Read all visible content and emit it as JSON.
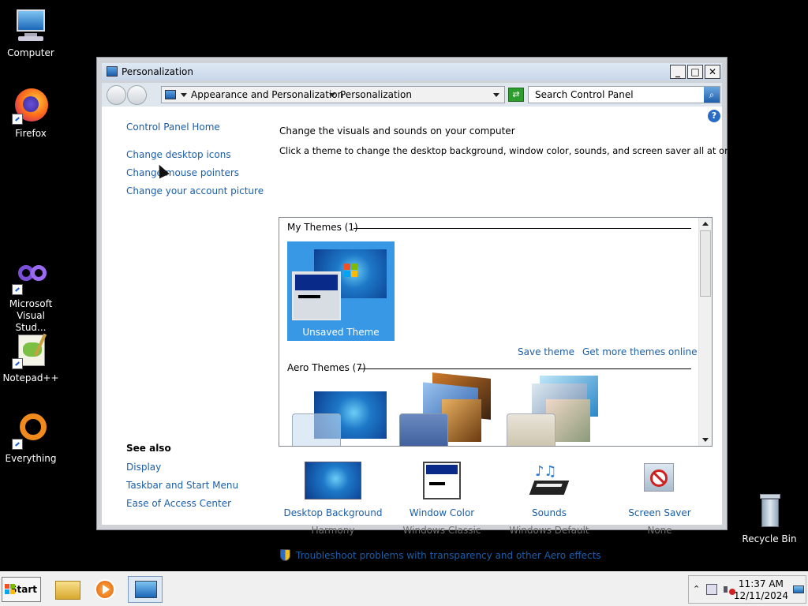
{
  "desktop": {
    "icons": [
      {
        "label": "Computer"
      },
      {
        "label": "Firefox"
      },
      {
        "label": "Microsoft Visual Stud..."
      },
      {
        "label": "Notepad++"
      },
      {
        "label": "Everything"
      },
      {
        "label": "Recycle Bin"
      }
    ]
  },
  "window": {
    "title": "Personalization",
    "buttons": {
      "minimize": "_",
      "maximize": "□",
      "close": "✕"
    },
    "address": {
      "crumbs": [
        "Appearance and Personalization",
        "Personalization"
      ]
    },
    "search_placeholder": "Search Control Panel",
    "help": "?"
  },
  "sidebar": {
    "home": "Control Panel Home",
    "links": [
      "Change desktop icons",
      "Change mouse pointers",
      "Change your account picture"
    ],
    "see_also_title": "See also",
    "see_also": [
      "Display",
      "Taskbar and Start Menu",
      "Ease of Access Center"
    ]
  },
  "main": {
    "heading": "Change the visuals and sounds on your computer",
    "subheading": "Click a theme to change the desktop background, window color, sounds, and screen saver all at once.",
    "my_themes_header": "My Themes (1)",
    "unsaved_theme": "Unsaved Theme",
    "save_theme": "Save theme",
    "get_more": "Get more themes online",
    "aero_header": "Aero Themes (7)",
    "tiles": [
      {
        "name": "Desktop Background",
        "value": "Harmony"
      },
      {
        "name": "Window Color",
        "value": "Windows Classic"
      },
      {
        "name": "Sounds",
        "value": "Windows Default"
      },
      {
        "name": "Screen Saver",
        "value": "None"
      }
    ],
    "troubleshoot": "Troubleshoot problems with transparency and other Aero effects"
  },
  "taskbar": {
    "start": "Start",
    "time": "11:37 AM",
    "date": "12/11/2024"
  },
  "colors": {
    "link": "#1a5ea8",
    "selection": "#3898e6"
  }
}
